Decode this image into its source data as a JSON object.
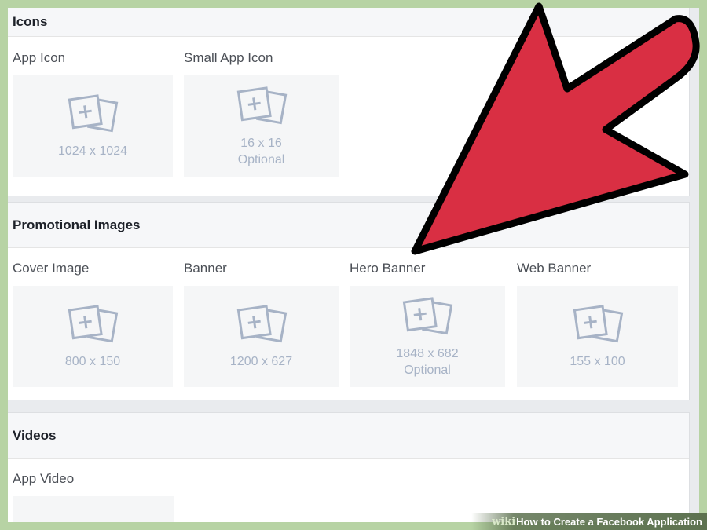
{
  "sections": {
    "icons": {
      "title": "Icons",
      "slots": [
        {
          "label": "App Icon",
          "size": "1024 x 1024"
        },
        {
          "label": "Small App Icon",
          "size": "16 x 16",
          "note": "Optional"
        }
      ]
    },
    "promotional": {
      "title": "Promotional Images",
      "slots": [
        {
          "label": "Cover Image",
          "size": "800 x 150"
        },
        {
          "label": "Banner",
          "size": "1200 x 627"
        },
        {
          "label": "Hero Banner",
          "size": "1848 x 682",
          "note": "Optional"
        },
        {
          "label": "Web Banner",
          "size": "155 x 100"
        }
      ]
    },
    "videos": {
      "title": "Videos",
      "slots": [
        {
          "label": "App Video"
        }
      ]
    }
  },
  "colors": {
    "arrow_fill": "#d92f43",
    "arrow_outline": "#000000",
    "frame_border": "#b7d3a4",
    "placeholder_text": "#a7b3c6"
  },
  "watermark": {
    "brand": "wiki",
    "how": "How",
    "rest": "to Create a Facebook Application"
  }
}
